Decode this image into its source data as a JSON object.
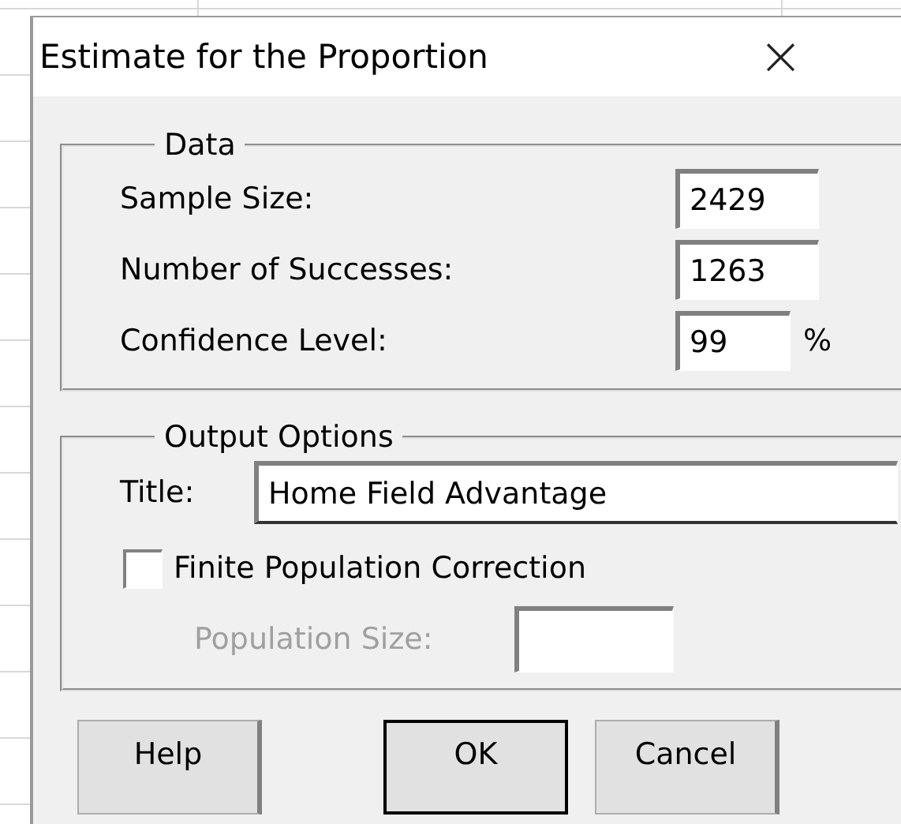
{
  "window": {
    "title": "Estimate for the Proportion",
    "close": "×"
  },
  "data_group": {
    "title": "Data",
    "fields": [
      {
        "label": "Sample Size:",
        "value": "2429"
      },
      {
        "label": "Number of Successes:",
        "value": "1263"
      },
      {
        "label": "Confidence Level:",
        "value": "99",
        "unit": "%"
      }
    ]
  },
  "output_group": {
    "title": "Output Options",
    "title_field": {
      "label": "Title:",
      "value": "Home Field Advantage"
    },
    "checkbox": {
      "label": "Finite Population Correction",
      "checked": false
    },
    "population_size": {
      "label": "Population Size:",
      "disabled": true
    }
  },
  "buttons": [
    {
      "label": "Help",
      "default": false
    },
    {
      "label": "OK",
      "default": true
    },
    {
      "label": "Cancel",
      "default": false
    }
  ]
}
